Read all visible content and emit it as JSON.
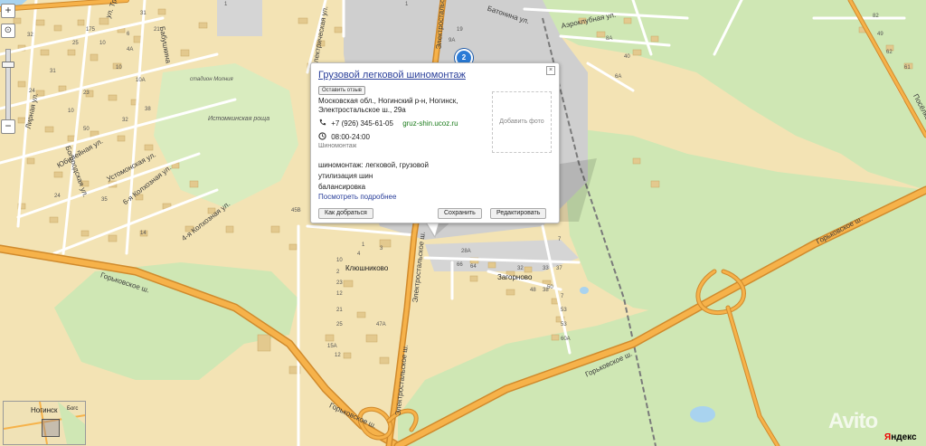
{
  "colors": {
    "land": "#f3e3b4",
    "forest": "#cfe7b4",
    "industrial": "#cfcfcf",
    "major_road": "#f6b24a",
    "road_casing": "#d08a2c",
    "minor_road": "#ffffff",
    "building": "#e3c98e",
    "water": "#a9d3ef",
    "railway": "#7a7a7a",
    "link": "#2a3f9a",
    "site_link": "#1a7b1a"
  },
  "zoom_control": {
    "zoom_in_icon": "plus",
    "zoom_out_icon": "minus",
    "ruler_icon": "ruler",
    "level_fraction": 0.82
  },
  "popup": {
    "title": "Грузовой легковой шиномонтаж",
    "close_icon": "close-x",
    "review_label": "Оставить отзыв",
    "address_lines": [
      "Московская обл., Ногинский р-н, Ногинск,",
      "Электростальское ш., 29а"
    ],
    "phone": "+7 (926) 345-61-05",
    "site": "gruz-shin.ucoz.ru",
    "hours": "08:00-24:00",
    "category": "Шиномонтаж",
    "description_lines": [
      "шиномонтаж: легковой, грузовой",
      "утилизация шин",
      "балансировка"
    ],
    "more_link": "Посмотреть подробнее",
    "add_photo": "Добавить фото",
    "route_button": "Как добраться",
    "save_button": "Сохранить",
    "edit_button": "Редактировать"
  },
  "marker": {
    "label": "2"
  },
  "map_labels": {
    "street_avia": "Аэроклубная ул.",
    "street_batov": "Батонина ул.",
    "street_electric": "Электрическая ул.",
    "street_electro": "Электростальская",
    "street_electrostalskoe_1": "Электростальское ш.",
    "street_electrostalskoe_2": "Электростальское ш.",
    "street_pos": "Посёлковая ул.",
    "street_gorkovskoe_1": "Горьковское ш.",
    "street_gorkovskoe_2": "Горьковское ш.",
    "street_gorkovskoe_3": "Горьковское ш.",
    "street_gorkovskoe_4": "Горьковское ш.",
    "street_ustom": "Устомонская ул.",
    "street_6kolh": "6-я Колхозная ул.",
    "street_4kolh": "4-я Колхозная ул.",
    "street_bogorod": "Богородская ул.",
    "street_yubil": "Юбилейная ул.",
    "street_babkina": "Бабушкина",
    "street_lira": "Лирная ул.",
    "street_up": "ул. Тр",
    "stadium": "стадион Молния",
    "grove": "Истомкинская роща",
    "village_1": "Клюшниково",
    "village_2": "Загорново",
    "mini_map_city": "Ногинск",
    "mini_map_extra": "Богс",
    "watermark": "Avito",
    "logo_first": "Я",
    "logo_rest": "ндекс"
  },
  "house_numbers": [
    "32",
    "175",
    "25",
    "10",
    "31",
    "21",
    "4А",
    "10",
    "10А",
    "31",
    "1",
    "24",
    "23",
    "38",
    "32",
    "50",
    "35",
    "24",
    "14",
    "9А",
    "19",
    "1",
    "6А",
    "40",
    "4",
    "3",
    "7",
    "10",
    "2",
    "12",
    "23",
    "21",
    "25",
    "15А",
    "47А",
    "53",
    "60А",
    "50",
    "66",
    "64",
    "28А",
    "53",
    "33",
    "37",
    "32",
    "38",
    "48",
    "62",
    "8А",
    "49",
    "61",
    "82",
    "6",
    "10",
    "1",
    "7",
    "45В",
    "12"
  ]
}
